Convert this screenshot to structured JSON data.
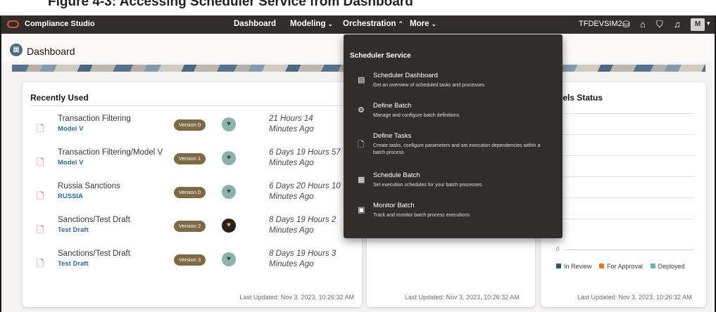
{
  "caption": "Figure 4-3: Accessing Scheduler Service from Dashboard",
  "topbar": {
    "app_name": "Compliance Studio",
    "nav": {
      "dashboard": "Dashboard",
      "modeling": "Modeling",
      "orchestration": "Orchestration",
      "more": "More"
    },
    "environment": "TFDEVSIM2",
    "user_initial": "M"
  },
  "page": {
    "title": "Dashboard"
  },
  "recently_used": {
    "title": "Recently Used",
    "items": [
      {
        "title": "Transaction Filtering",
        "subtitle": "Model V",
        "version": "Version 0",
        "ago_line1": "21 Hours 14",
        "ago_line2": "Minutes Ago",
        "badge": "dark-false"
      },
      {
        "title": "Transaction Filtering/Model V",
        "subtitle": "Model V",
        "version": "Version 1",
        "ago_line1": "6 Days 19 Hours 57",
        "ago_line2": "Minutes Ago",
        "badge": "dark-false"
      },
      {
        "title": "Russia Sanctions",
        "subtitle": "RUSSIA",
        "version": "Version 0",
        "ago_line1": "6 Days 20 Hours 10",
        "ago_line2": "Minutes Ago",
        "badge": "dark-false"
      },
      {
        "title": "Sanctions/Test Draft",
        "subtitle": "Test Draft",
        "version": "Version 2",
        "ago_line1": "8 Days 19 Hours 2",
        "ago_line2": "Minutes Ago",
        "badge": "dark-true"
      },
      {
        "title": "Sanctions/Test Draft",
        "subtitle": "Test Draft",
        "version": "Version 3",
        "ago_line1": "8 Days 19 Hours 3",
        "ago_line2": "Minutes Ago",
        "badge": "dark-false"
      }
    ],
    "last_updated": "Last Updated: Nov 3, 2023, 10:26:32 AM"
  },
  "middle_card": {
    "last_updated": "Last Updated: Nov 3, 2023, 10:26:32 AM"
  },
  "models_status": {
    "title_visible": "dels Status",
    "zero_label": "0",
    "legend": [
      {
        "label": "In Review",
        "color": "#2d5a6e"
      },
      {
        "label": "For Approval",
        "color": "#e07b2a"
      },
      {
        "label": "Deployed",
        "color": "#5fb8bb"
      }
    ],
    "last_updated": "Last Updated: Nov 3, 2023, 10:26:32 AM"
  },
  "scheduler_menu": {
    "header": "Scheduler Service",
    "items": [
      {
        "label": "Scheduler Dashboard",
        "desc": "Get an overview of scheduled tasks and processes",
        "icon": "dashboard-icon"
      },
      {
        "label": "Define Batch",
        "desc": "Manage and configure batch definitions",
        "icon": "batch-icon"
      },
      {
        "label": "Define Tasks",
        "desc": "Create tasks, configure parameters and set execution dependencies within a batch process",
        "icon": "task-icon"
      },
      {
        "label": "Schedule Batch",
        "desc": "Set execution schedules for your batch processes",
        "icon": "calendar-icon"
      },
      {
        "label": "Monitor Batch",
        "desc": "Track and monitor batch process executions",
        "icon": "monitor-icon"
      }
    ]
  }
}
